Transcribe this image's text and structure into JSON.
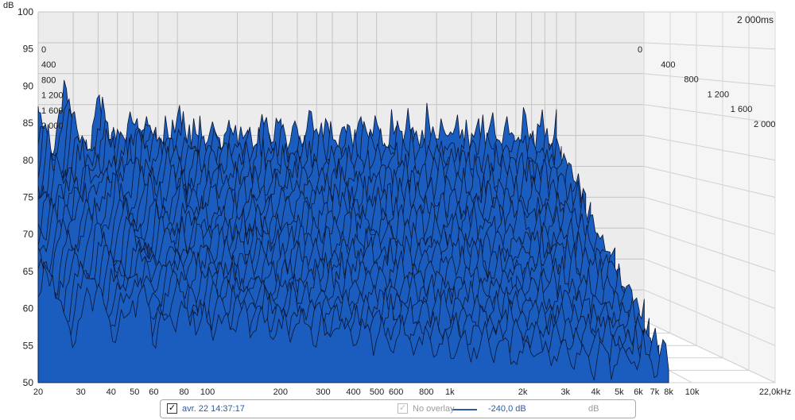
{
  "chart_data": {
    "type": "area",
    "subtype": "waterfall-3d",
    "ylabel": "dB",
    "ylim": [
      50,
      100
    ],
    "yticks": [
      50,
      55,
      60,
      65,
      70,
      75,
      80,
      85,
      90,
      95,
      100
    ],
    "xlabel": "",
    "x_scale": "log",
    "xlim": [
      20,
      22000
    ],
    "xticks": [
      {
        "value": 20,
        "label": "20"
      },
      {
        "value": 30,
        "label": "30"
      },
      {
        "value": 40,
        "label": "40"
      },
      {
        "value": 50,
        "label": "50"
      },
      {
        "value": 60,
        "label": "60"
      },
      {
        "value": 80,
        "label": "80"
      },
      {
        "value": 100,
        "label": "100"
      },
      {
        "value": 200,
        "label": "200"
      },
      {
        "value": 300,
        "label": "300"
      },
      {
        "value": 400,
        "label": "400"
      },
      {
        "value": 500,
        "label": "500"
      },
      {
        "value": 600,
        "label": "600"
      },
      {
        "value": 800,
        "label": "800"
      },
      {
        "value": 1000,
        "label": "1k"
      },
      {
        "value": 2000,
        "label": "2k"
      },
      {
        "value": 3000,
        "label": "3k"
      },
      {
        "value": 4000,
        "label": "4k"
      },
      {
        "value": 5000,
        "label": "5k"
      },
      {
        "value": 6000,
        "label": "6k"
      },
      {
        "value": 7000,
        "label": "7k"
      },
      {
        "value": 8000,
        "label": "8k"
      },
      {
        "value": 10000,
        "label": "10k"
      },
      {
        "value": 22000,
        "label": "22,0kHz"
      }
    ],
    "time_axis_label": "2 000ms",
    "time_ticks": [
      "0",
      "400",
      "800",
      "1 200",
      "1 600",
      "2 000"
    ],
    "time_unit": "ms",
    "slices": 24,
    "grid": true,
    "surface_color": "#1a5dbf",
    "edge_color": "#0b1630"
  },
  "legend": {
    "checked": true,
    "date_label": "avr. 22 14:37:17",
    "threshold_label": "-240,0 dB",
    "overlay_label": "No overlay",
    "unit_label": "dB",
    "series_color": "#2a5aa8"
  }
}
